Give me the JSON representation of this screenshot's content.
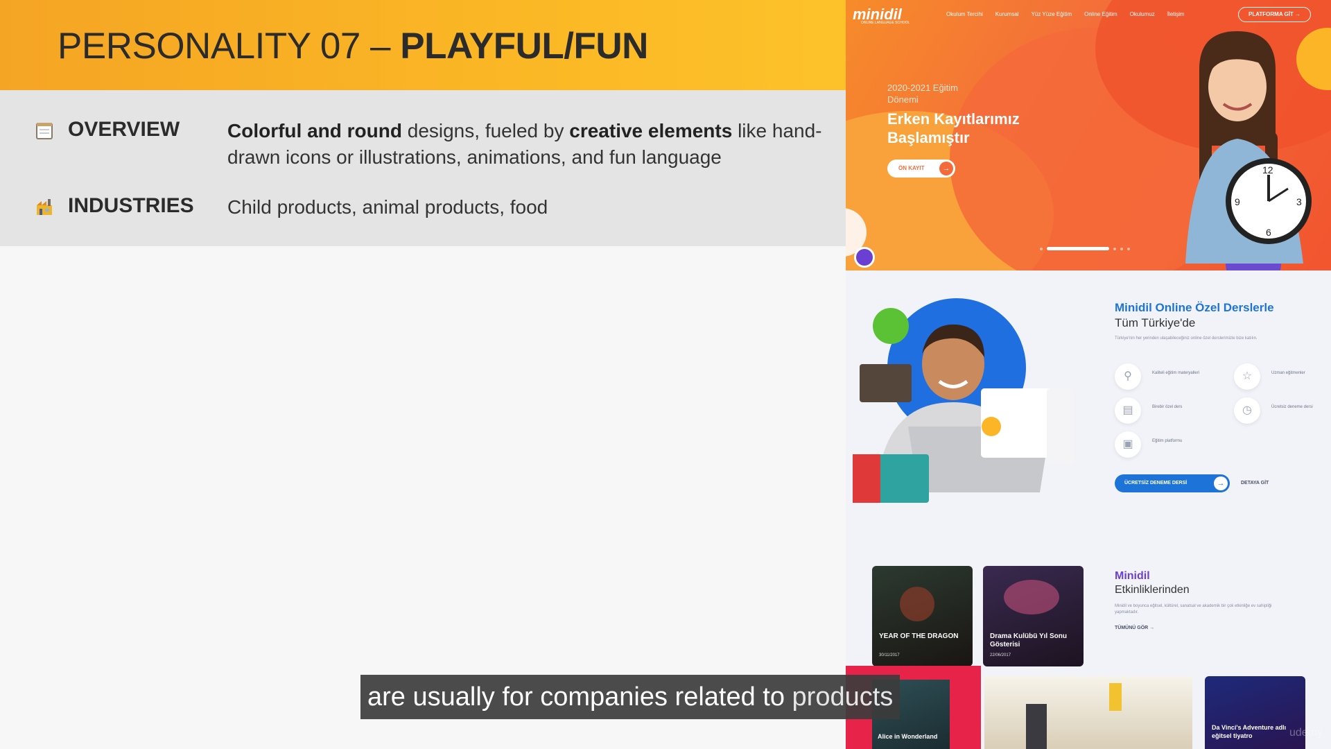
{
  "slide": {
    "title_prefix": "PERSONALITY 07 – ",
    "title_bold": "PLAYFUL/FUN",
    "overview": {
      "label": "OVERVIEW",
      "bold1": "Colorful and round",
      "text1": " designs, fueled by ",
      "bold2": "creative elements",
      "text2": " like hand-drawn icons or illustrations, animations, and fun language"
    },
    "industries": {
      "label": "INDUSTRIES",
      "text": "Child products, animal products, food"
    }
  },
  "site": {
    "logo": "minidil",
    "logo_sub": "ONLINE LANGUAGE SCHOOL",
    "nav": [
      "Okulum Tercihi",
      "Kurumsal",
      "Yüz Yüze Eğitim",
      "Online Eğitim",
      "Okulumuz",
      "İletişim"
    ],
    "nav_button": "PLATFORMA GİT →",
    "hero": {
      "small": "2020-2021 Eğitim Dönemi",
      "big": "Erken Kayıtlarımız Başlamıştır",
      "button": "ÖN KAYIT",
      "button_arrow": "→"
    },
    "online": {
      "title": "Minidil Online Özel Derslerle",
      "subtitle": "Tüm Türkiye'de",
      "description": "Türkiye'nin her yerinden ulaşabileceğiniz online özel derslerimizle bize katılın.",
      "features": [
        {
          "icon": "⚲",
          "label": "Kaliteli eğitim materyalleri"
        },
        {
          "icon": "☆",
          "label": "Uzman eğitmenler"
        },
        {
          "icon": "▤",
          "label": "Birebir özel ders"
        },
        {
          "icon": "◷",
          "label": "Ücretsiz deneme dersi"
        },
        {
          "icon": "▣",
          "label": "Eğitim platformu"
        }
      ],
      "button": "ÜCRETSİZ DENEME DERSİ",
      "button_arrow": "→",
      "link": "DETAYA GİT"
    },
    "events": {
      "title": "Minidil",
      "subtitle": "Etkinliklerinden",
      "description": "Minidil ve boyunca eğitsel, kültürel, sanatsal ve akademik bir çok etkinliğe ev sahipliği yapmaktadır.",
      "link": "TÜMÜNÜ GÖR →",
      "cards": [
        {
          "title": "YEAR OF THE DRAGON",
          "date": "30/11/2017"
        },
        {
          "title": "Drama Kulübü Yıl Sonu Gösterisi",
          "date": "22/06/2017"
        },
        {
          "title": "Alice in Wonderland",
          "date": ""
        },
        {
          "title": "",
          "date": ""
        },
        {
          "title": "Da Vinci's Adventure adlı eğitsel tiyatro",
          "date": ""
        }
      ]
    },
    "watermark": "udemy"
  },
  "caption": {
    "text_start": "are usually for companies related to ",
    "text_highlight": "products"
  },
  "colors": {
    "header_orange": "#f7a823",
    "hero_orange": "#f36b3b",
    "accent_blue": "#1e73d8",
    "accent_purple": "#6a3fd1"
  }
}
